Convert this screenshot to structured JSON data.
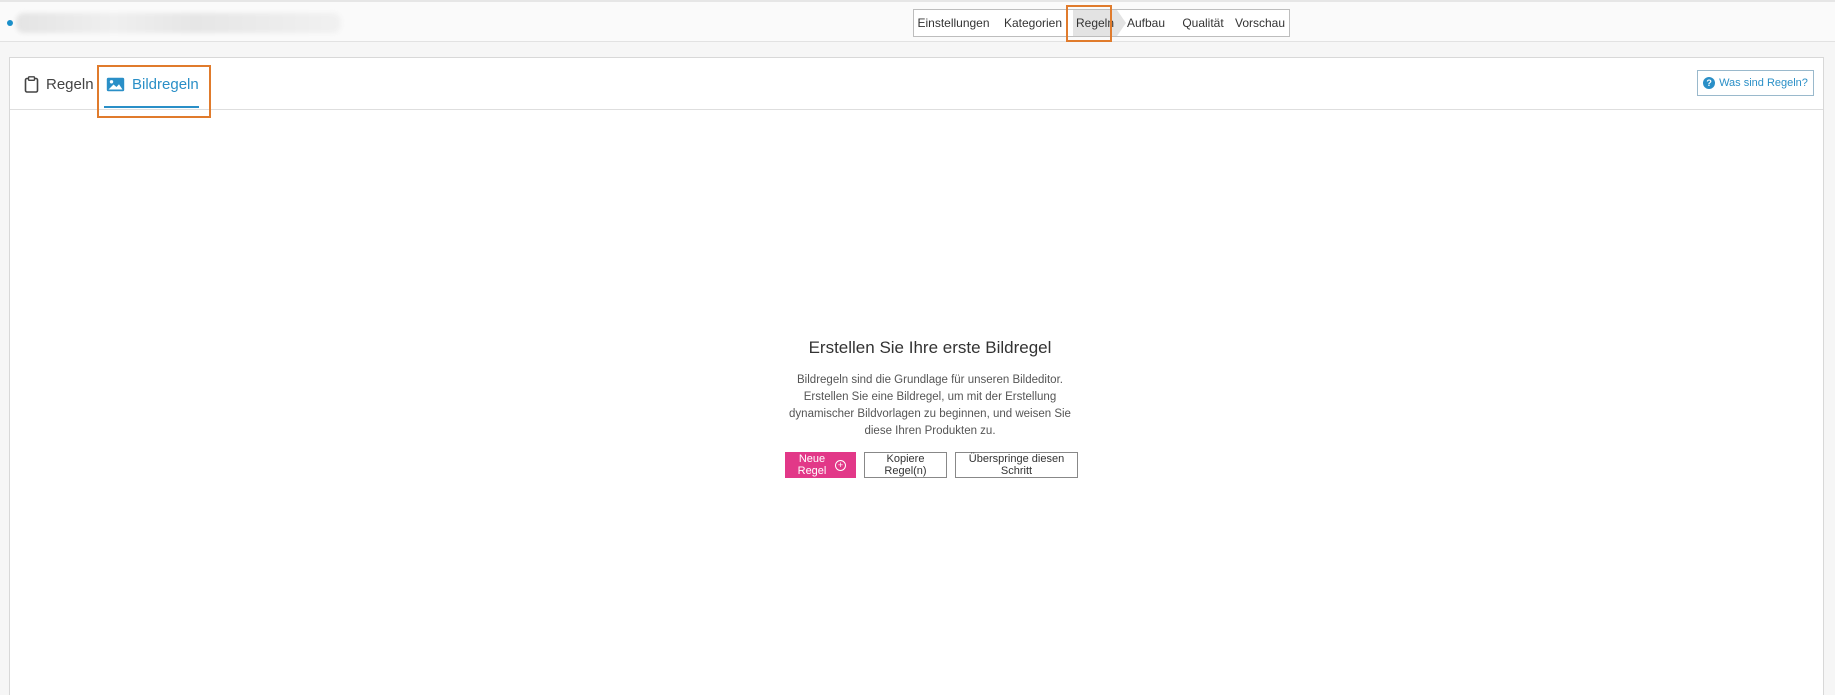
{
  "steps": [
    {
      "label": "Einstellungen"
    },
    {
      "label": "Kategorien"
    },
    {
      "label": "Regeln"
    },
    {
      "label": "Aufbau"
    },
    {
      "label": "Qualität"
    },
    {
      "label": "Vorschau"
    }
  ],
  "active_step": "Regeln",
  "tabs": {
    "regeln": "Regeln",
    "bildregeln": "Bildregeln"
  },
  "help_button": "Was sind Regeln?",
  "empty_state": {
    "title": "Erstellen Sie Ihre erste Bildregel",
    "description": "Bildregeln sind die Grundlage für unseren Bildeditor. Erstellen Sie eine Bildregel, um mit der Erstellung dynamischer Bildvorlagen zu beginnen, und weisen Sie diese Ihren Produkten zu.",
    "new_rule": "Neue Regel",
    "copy_rules": "Kopiere Regel(n)",
    "skip_step": "Überspringe diesen Schritt"
  },
  "colors": {
    "accent": "#2a8fc7",
    "primary_button": "#e23888",
    "highlight": "#e07b2c"
  }
}
